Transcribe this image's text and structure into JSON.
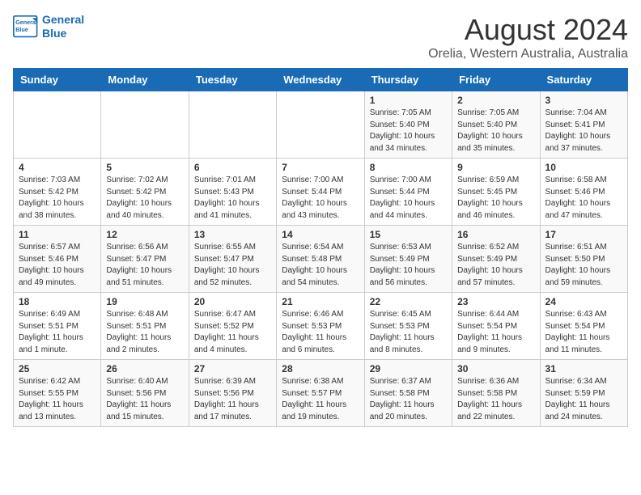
{
  "header": {
    "logo_line1": "General",
    "logo_line2": "Blue",
    "title": "August 2024",
    "subtitle": "Orelia, Western Australia, Australia"
  },
  "days_of_week": [
    "Sunday",
    "Monday",
    "Tuesday",
    "Wednesday",
    "Thursday",
    "Friday",
    "Saturday"
  ],
  "weeks": [
    [
      {
        "day": "",
        "info": ""
      },
      {
        "day": "",
        "info": ""
      },
      {
        "day": "",
        "info": ""
      },
      {
        "day": "",
        "info": ""
      },
      {
        "day": "1",
        "info": "Sunrise: 7:05 AM\nSunset: 5:40 PM\nDaylight: 10 hours\nand 34 minutes."
      },
      {
        "day": "2",
        "info": "Sunrise: 7:05 AM\nSunset: 5:40 PM\nDaylight: 10 hours\nand 35 minutes."
      },
      {
        "day": "3",
        "info": "Sunrise: 7:04 AM\nSunset: 5:41 PM\nDaylight: 10 hours\nand 37 minutes."
      }
    ],
    [
      {
        "day": "4",
        "info": "Sunrise: 7:03 AM\nSunset: 5:42 PM\nDaylight: 10 hours\nand 38 minutes."
      },
      {
        "day": "5",
        "info": "Sunrise: 7:02 AM\nSunset: 5:42 PM\nDaylight: 10 hours\nand 40 minutes."
      },
      {
        "day": "6",
        "info": "Sunrise: 7:01 AM\nSunset: 5:43 PM\nDaylight: 10 hours\nand 41 minutes."
      },
      {
        "day": "7",
        "info": "Sunrise: 7:00 AM\nSunset: 5:44 PM\nDaylight: 10 hours\nand 43 minutes."
      },
      {
        "day": "8",
        "info": "Sunrise: 7:00 AM\nSunset: 5:44 PM\nDaylight: 10 hours\nand 44 minutes."
      },
      {
        "day": "9",
        "info": "Sunrise: 6:59 AM\nSunset: 5:45 PM\nDaylight: 10 hours\nand 46 minutes."
      },
      {
        "day": "10",
        "info": "Sunrise: 6:58 AM\nSunset: 5:46 PM\nDaylight: 10 hours\nand 47 minutes."
      }
    ],
    [
      {
        "day": "11",
        "info": "Sunrise: 6:57 AM\nSunset: 5:46 PM\nDaylight: 10 hours\nand 49 minutes."
      },
      {
        "day": "12",
        "info": "Sunrise: 6:56 AM\nSunset: 5:47 PM\nDaylight: 10 hours\nand 51 minutes."
      },
      {
        "day": "13",
        "info": "Sunrise: 6:55 AM\nSunset: 5:47 PM\nDaylight: 10 hours\nand 52 minutes."
      },
      {
        "day": "14",
        "info": "Sunrise: 6:54 AM\nSunset: 5:48 PM\nDaylight: 10 hours\nand 54 minutes."
      },
      {
        "day": "15",
        "info": "Sunrise: 6:53 AM\nSunset: 5:49 PM\nDaylight: 10 hours\nand 56 minutes."
      },
      {
        "day": "16",
        "info": "Sunrise: 6:52 AM\nSunset: 5:49 PM\nDaylight: 10 hours\nand 57 minutes."
      },
      {
        "day": "17",
        "info": "Sunrise: 6:51 AM\nSunset: 5:50 PM\nDaylight: 10 hours\nand 59 minutes."
      }
    ],
    [
      {
        "day": "18",
        "info": "Sunrise: 6:49 AM\nSunset: 5:51 PM\nDaylight: 11 hours\nand 1 minute."
      },
      {
        "day": "19",
        "info": "Sunrise: 6:48 AM\nSunset: 5:51 PM\nDaylight: 11 hours\nand 2 minutes."
      },
      {
        "day": "20",
        "info": "Sunrise: 6:47 AM\nSunset: 5:52 PM\nDaylight: 11 hours\nand 4 minutes."
      },
      {
        "day": "21",
        "info": "Sunrise: 6:46 AM\nSunset: 5:53 PM\nDaylight: 11 hours\nand 6 minutes."
      },
      {
        "day": "22",
        "info": "Sunrise: 6:45 AM\nSunset: 5:53 PM\nDaylight: 11 hours\nand 8 minutes."
      },
      {
        "day": "23",
        "info": "Sunrise: 6:44 AM\nSunset: 5:54 PM\nDaylight: 11 hours\nand 9 minutes."
      },
      {
        "day": "24",
        "info": "Sunrise: 6:43 AM\nSunset: 5:54 PM\nDaylight: 11 hours\nand 11 minutes."
      }
    ],
    [
      {
        "day": "25",
        "info": "Sunrise: 6:42 AM\nSunset: 5:55 PM\nDaylight: 11 hours\nand 13 minutes."
      },
      {
        "day": "26",
        "info": "Sunrise: 6:40 AM\nSunset: 5:56 PM\nDaylight: 11 hours\nand 15 minutes."
      },
      {
        "day": "27",
        "info": "Sunrise: 6:39 AM\nSunset: 5:56 PM\nDaylight: 11 hours\nand 17 minutes."
      },
      {
        "day": "28",
        "info": "Sunrise: 6:38 AM\nSunset: 5:57 PM\nDaylight: 11 hours\nand 19 minutes."
      },
      {
        "day": "29",
        "info": "Sunrise: 6:37 AM\nSunset: 5:58 PM\nDaylight: 11 hours\nand 20 minutes."
      },
      {
        "day": "30",
        "info": "Sunrise: 6:36 AM\nSunset: 5:58 PM\nDaylight: 11 hours\nand 22 minutes."
      },
      {
        "day": "31",
        "info": "Sunrise: 6:34 AM\nSunset: 5:59 PM\nDaylight: 11 hours\nand 24 minutes."
      }
    ]
  ]
}
